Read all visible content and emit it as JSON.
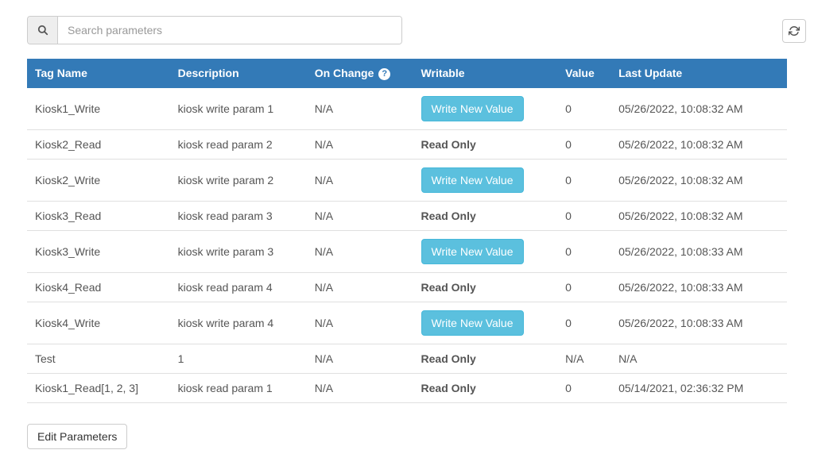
{
  "search": {
    "placeholder": "Search parameters"
  },
  "columns": {
    "tag": "Tag Name",
    "desc": "Description",
    "onchange": "On Change",
    "writable": "Writable",
    "value": "Value",
    "update": "Last Update"
  },
  "help_icon": "?",
  "buttons": {
    "write": "Write New Value",
    "edit": "Edit Parameters",
    "readonly": "Read Only"
  },
  "rows": [
    {
      "tag": "Kiosk1_Write",
      "desc": "kiosk write param 1",
      "onchange": "N/A",
      "writable": "button",
      "value": "0",
      "update": "05/26/2022, 10:08:32 AM"
    },
    {
      "tag": "Kiosk2_Read",
      "desc": "kiosk read param 2",
      "onchange": "N/A",
      "writable": "readonly",
      "value": "0",
      "update": "05/26/2022, 10:08:32 AM"
    },
    {
      "tag": "Kiosk2_Write",
      "desc": "kiosk write param 2",
      "onchange": "N/A",
      "writable": "button",
      "value": "0",
      "update": "05/26/2022, 10:08:32 AM"
    },
    {
      "tag": "Kiosk3_Read",
      "desc": "kiosk read param 3",
      "onchange": "N/A",
      "writable": "readonly",
      "value": "0",
      "update": "05/26/2022, 10:08:32 AM"
    },
    {
      "tag": "Kiosk3_Write",
      "desc": "kiosk write param 3",
      "onchange": "N/A",
      "writable": "button",
      "value": "0",
      "update": "05/26/2022, 10:08:33 AM"
    },
    {
      "tag": "Kiosk4_Read",
      "desc": "kiosk read param 4",
      "onchange": "N/A",
      "writable": "readonly",
      "value": "0",
      "update": "05/26/2022, 10:08:33 AM"
    },
    {
      "tag": "Kiosk4_Write",
      "desc": "kiosk write param 4",
      "onchange": "N/A",
      "writable": "button",
      "value": "0",
      "update": "05/26/2022, 10:08:33 AM"
    },
    {
      "tag": "Test",
      "desc": "1",
      "onchange": "N/A",
      "writable": "readonly",
      "value": "N/A",
      "update": "N/A"
    },
    {
      "tag": "Kiosk1_Read[1, 2, 3]",
      "desc": "kiosk read param 1",
      "onchange": "N/A",
      "writable": "readonly",
      "value": "0",
      "update": "05/14/2021, 02:36:32 PM"
    }
  ]
}
